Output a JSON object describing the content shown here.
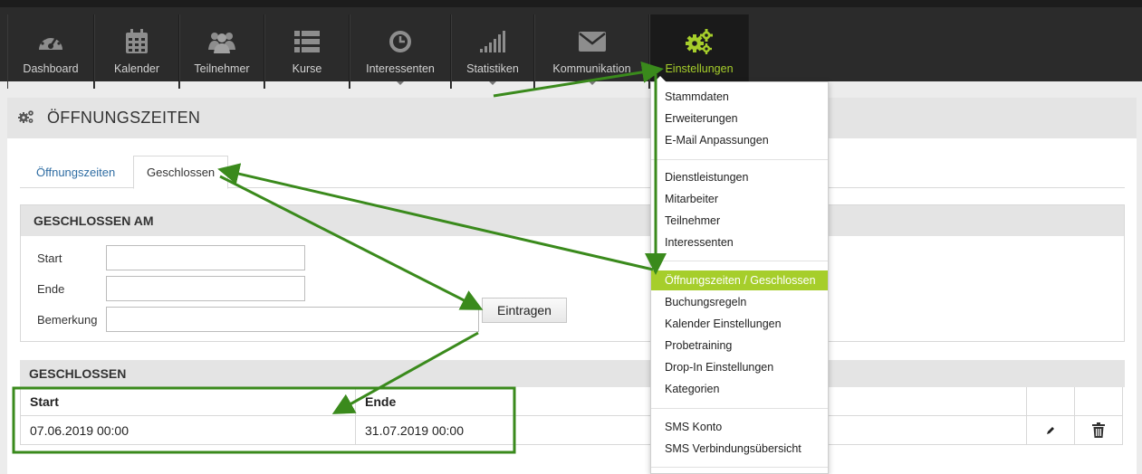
{
  "nav": {
    "items": [
      {
        "label": "Dashboard",
        "icon": "dashboard-icon"
      },
      {
        "label": "Kalender",
        "icon": "calendar-icon"
      },
      {
        "label": "Teilnehmer",
        "icon": "users-icon"
      },
      {
        "label": "Kurse",
        "icon": "list-icon"
      },
      {
        "label": "Interessenten",
        "icon": "clock-icon"
      },
      {
        "label": "Statistiken",
        "icon": "signal-icon"
      },
      {
        "label": "Kommunikation",
        "icon": "envelope-icon"
      },
      {
        "label": "Einstellungen",
        "icon": "gears-icon"
      }
    ],
    "active_color": "#a6ce2b"
  },
  "page": {
    "title": "ÖFFNUNGSZEITEN",
    "title_icon": "gears-icon"
  },
  "tabs": {
    "oeffnungszeiten": "Öffnungszeiten",
    "geschlossen": "Geschlossen"
  },
  "form": {
    "heading": "GESCHLOSSEN AM",
    "start_label": "Start",
    "ende_label": "Ende",
    "bemerkung_label": "Bemerkung",
    "start_value": "",
    "ende_value": "",
    "bemerkung_value": "",
    "submit_label": "Eintragen"
  },
  "closed": {
    "heading": "GESCHLOSSEN",
    "columns": [
      "Start",
      "Ende"
    ],
    "rows": [
      {
        "start": "07.06.2019 00:00",
        "ende": "31.07.2019 00:00"
      }
    ],
    "edit_icon": "pencil-icon",
    "delete_icon": "trash-icon"
  },
  "menu": {
    "group1": [
      "Stammdaten",
      "Erweiterungen",
      "E-Mail Anpassungen"
    ],
    "group2": [
      "Dienstleistungen",
      "Mitarbeiter",
      "Teilnehmer",
      "Interessenten"
    ],
    "group3": [
      "Öffnungszeiten / Geschlossen",
      "Buchungsregeln",
      "Kalender Einstellungen",
      "Probetraining",
      "Drop-In Einstellungen",
      "Kategorien"
    ],
    "group4": [
      "SMS Konto",
      "SMS Verbindungsübersicht"
    ],
    "highlight_color": "#a6ce2b"
  },
  "annotation_color": "#3a8a1c"
}
